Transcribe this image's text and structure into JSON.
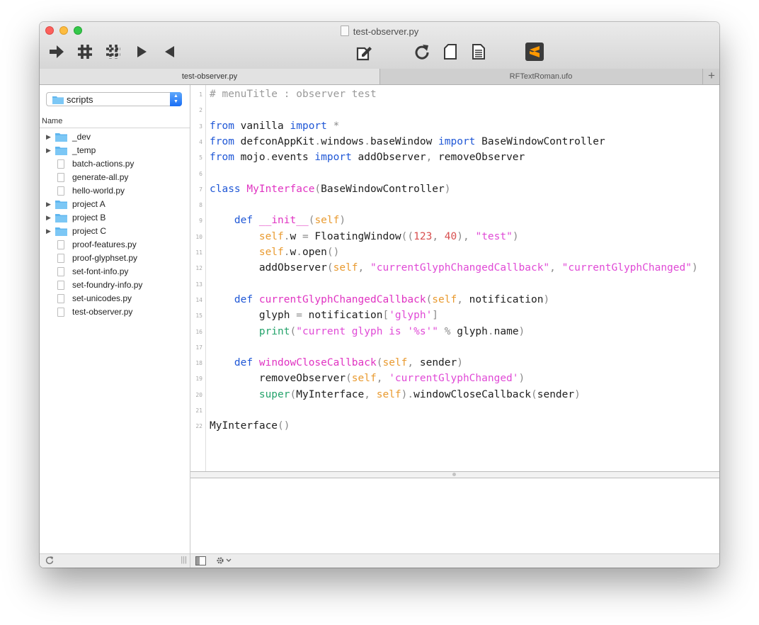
{
  "window": {
    "title": "test-observer.py",
    "toolbar_icons": [
      "run-arrow-icon",
      "comment-hash-icon",
      "uncomment-hash-icon",
      "indent-right-icon",
      "dedent-left-icon",
      "edit-document-icon",
      "reload-icon",
      "new-document-icon",
      "open-document-icon",
      "sublime-text-icon"
    ]
  },
  "tabs": [
    {
      "label": "test-observer.py",
      "active": true
    },
    {
      "label": "RFTextRoman.ufo",
      "active": false
    }
  ],
  "tab_add_label": "+",
  "sidebar": {
    "folder_popup": "scripts",
    "column_header": "Name",
    "items": [
      {
        "name": "_dev",
        "type": "folder"
      },
      {
        "name": "_temp",
        "type": "folder"
      },
      {
        "name": "batch-actions.py",
        "type": "file"
      },
      {
        "name": "generate-all.py",
        "type": "file"
      },
      {
        "name": "hello-world.py",
        "type": "file"
      },
      {
        "name": "project A",
        "type": "folder"
      },
      {
        "name": "project B",
        "type": "folder"
      },
      {
        "name": "project C",
        "type": "folder"
      },
      {
        "name": "proof-features.py",
        "type": "file"
      },
      {
        "name": "proof-glyphset.py",
        "type": "file"
      },
      {
        "name": "set-font-info.py",
        "type": "file"
      },
      {
        "name": "set-foundry-info.py",
        "type": "file"
      },
      {
        "name": "set-unicodes.py",
        "type": "file"
      },
      {
        "name": "test-observer.py",
        "type": "file"
      }
    ]
  },
  "editor": {
    "line_numbers": [
      "1",
      "2",
      "3",
      "4",
      "5",
      "6",
      "7",
      "8",
      "9",
      "10",
      "11",
      "12",
      "13",
      "14",
      "15",
      "16",
      "17",
      "18",
      "19",
      "20",
      "21",
      "22"
    ],
    "lines": [
      "# menuTitle : observer test",
      "",
      "from vanilla import *",
      "from defconAppKit.windows.baseWindow import BaseWindowController",
      "from mojo.events import addObserver, removeObserver",
      "",
      "class MyInterface(BaseWindowController):",
      "",
      "    def __init__(self):",
      "        self.w = FloatingWindow((123, 40), \"test\")",
      "        self.w.open()",
      "        addObserver(self, \"currentGlyphChangedCallback\", \"currentGlyphChanged\")",
      "",
      "    def currentGlyphChangedCallback(self, notification):",
      "        glyph = notification['glyph']",
      "        print(\"current glyph is '%s'\" % glyph.name)",
      "",
      "    def windowCloseCallback(self, sender):",
      "        removeObserver(self, 'currentGlyphChanged')",
      "        super(MyInterface, self).windowCloseCallback(sender)",
      "",
      "MyInterface()"
    ]
  },
  "colors": {
    "keyword": "#1f57d6",
    "class_name": "#e033c2",
    "self": "#e99a2f",
    "string": "#e04ad6",
    "number": "#d84f4f",
    "builtin": "#24a36b",
    "comment": "#9a9a9a",
    "accent": "#1a6ef5"
  }
}
